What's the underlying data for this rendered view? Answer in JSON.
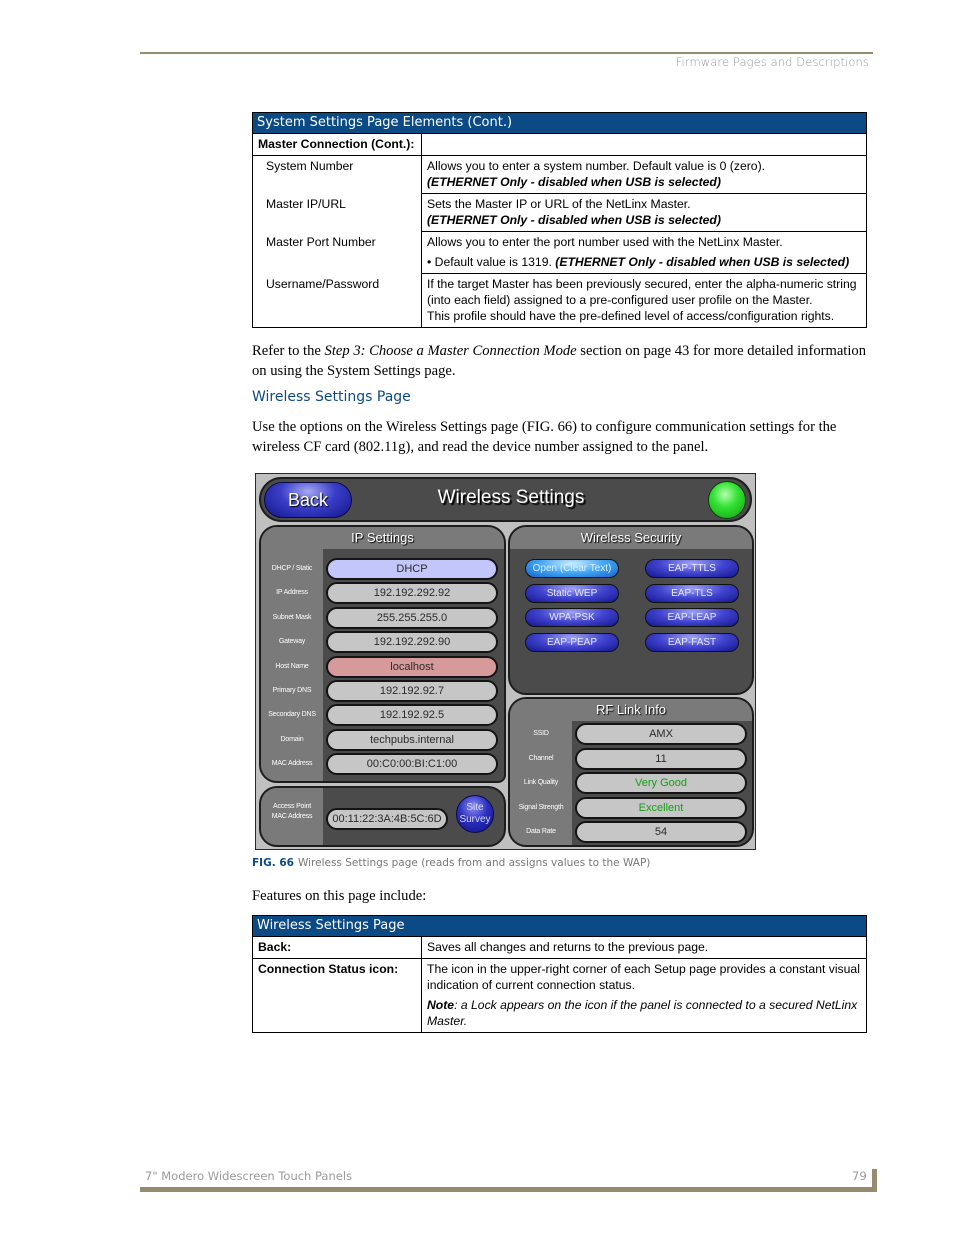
{
  "header": {
    "running_head": "Firmware Pages and Descriptions"
  },
  "table1": {
    "title": "System Settings Page Elements (Cont.)",
    "group_label": "Master Connection (Cont.):",
    "rows": [
      {
        "label": "System Number",
        "lines": [
          "Allows you to enter a system number. Default value is 0 (zero)."
        ],
        "emphasis": "(ETHERNET Only - disabled when USB is selected)"
      },
      {
        "label": "Master IP/URL",
        "lines": [
          "Sets the Master IP or URL of the NetLinx Master."
        ],
        "emphasis": "(ETHERNET Only - disabled when USB is selected)"
      },
      {
        "label": "Master Port Number",
        "lines": [
          "Allows you to enter the port number used with the NetLinx Master."
        ],
        "bullet": "• Default value is 1319.",
        "emphasis": "(ETHERNET Only - disabled when USB is selected)"
      },
      {
        "label": "Username/Password",
        "lines": [
          "If the target Master has been previously secured, enter the alpha-numeric string (into each field) assigned to a pre-configured user profile on the Master.",
          "This profile should have the pre-defined level of access/configuration rights."
        ]
      }
    ]
  },
  "refer_para": {
    "before": "Refer to the ",
    "italic": "Step 3: Choose a Master Connection Mode",
    "after": " section on page 43 for more detailed information on using the System Settings page."
  },
  "section_heading": "Wireless Settings Page",
  "intro_para": "Use the options on the Wireless Settings page (FIG. 66) to configure communication settings for the wireless CF card (802.11g), and read the device number assigned to the panel.",
  "panel": {
    "back_label": "Back",
    "title": "Wireless Settings",
    "status_color": "#35e235",
    "ip_settings": {
      "title": "IP Settings",
      "fields": [
        {
          "label": "DHCP / Static",
          "value": "DHCP",
          "color": "#c3c6fb"
        },
        {
          "label": "IP Address",
          "value": "192.192.292.92"
        },
        {
          "label": "Subnet Mask",
          "value": "255.255.255.0"
        },
        {
          "label": "Gateway",
          "value": "192.192.292.90"
        },
        {
          "label": "Host Name",
          "value": "localhost",
          "color": "#d79a9a"
        },
        {
          "label": "Primary DNS",
          "value": "192.192.92.7"
        },
        {
          "label": "Secondary DNS",
          "value": "192.192.92.5"
        },
        {
          "label": "Domain",
          "value": "techpubs.internal"
        },
        {
          "label": "MAC Address",
          "value": "00:C0:00:BI:C1:00"
        }
      ]
    },
    "access_point": {
      "label_line1": "Access Point",
      "label_line2": "MAC Address",
      "value": "00:11:22:3A:4B:5C:6D",
      "survey_line1": "Site",
      "survey_line2": "Survey"
    },
    "wireless_security": {
      "title": "Wireless Security",
      "left_buttons": [
        "Open (Clear Text)",
        "Static WEP",
        "WPA-PSK",
        "EAP-PEAP"
      ],
      "right_buttons": [
        "EAP-TTLS",
        "EAP-TLS",
        "EAP-LEAP",
        "EAP-FAST"
      ],
      "selected": "Open (Clear Text)"
    },
    "rf_link": {
      "title": "RF Link Info",
      "fields": [
        {
          "label": "SSID",
          "value": "AMX"
        },
        {
          "label": "Channel",
          "value": "11"
        },
        {
          "label": "Link Quality",
          "value": "Very Good",
          "text_color": "#14a014"
        },
        {
          "label": "Signal Strength",
          "value": "Excellent",
          "text_color": "#14a014"
        },
        {
          "label": "Data Rate",
          "value": "54"
        }
      ]
    }
  },
  "caption": {
    "fig": "FIG. 66",
    "text": "Wireless Settings page (reads from and assigns values to the WAP)"
  },
  "features_para": "Features on this page include:",
  "table2": {
    "title": "Wireless Settings Page",
    "rows": [
      {
        "label": "Back:",
        "text": "Saves all changes and returns to the previous page."
      },
      {
        "label": "Connection Status icon:",
        "text": "The icon in the upper-right corner of each Setup page provides a constant visual indication of current connection status.",
        "note_bold": "Note",
        "note_rest": ": a Lock appears on the icon if the panel is connected to a secured NetLinx Master."
      }
    ]
  },
  "footer": {
    "title": "7\" Modero Widescreen Touch Panels",
    "page_number": "79"
  }
}
